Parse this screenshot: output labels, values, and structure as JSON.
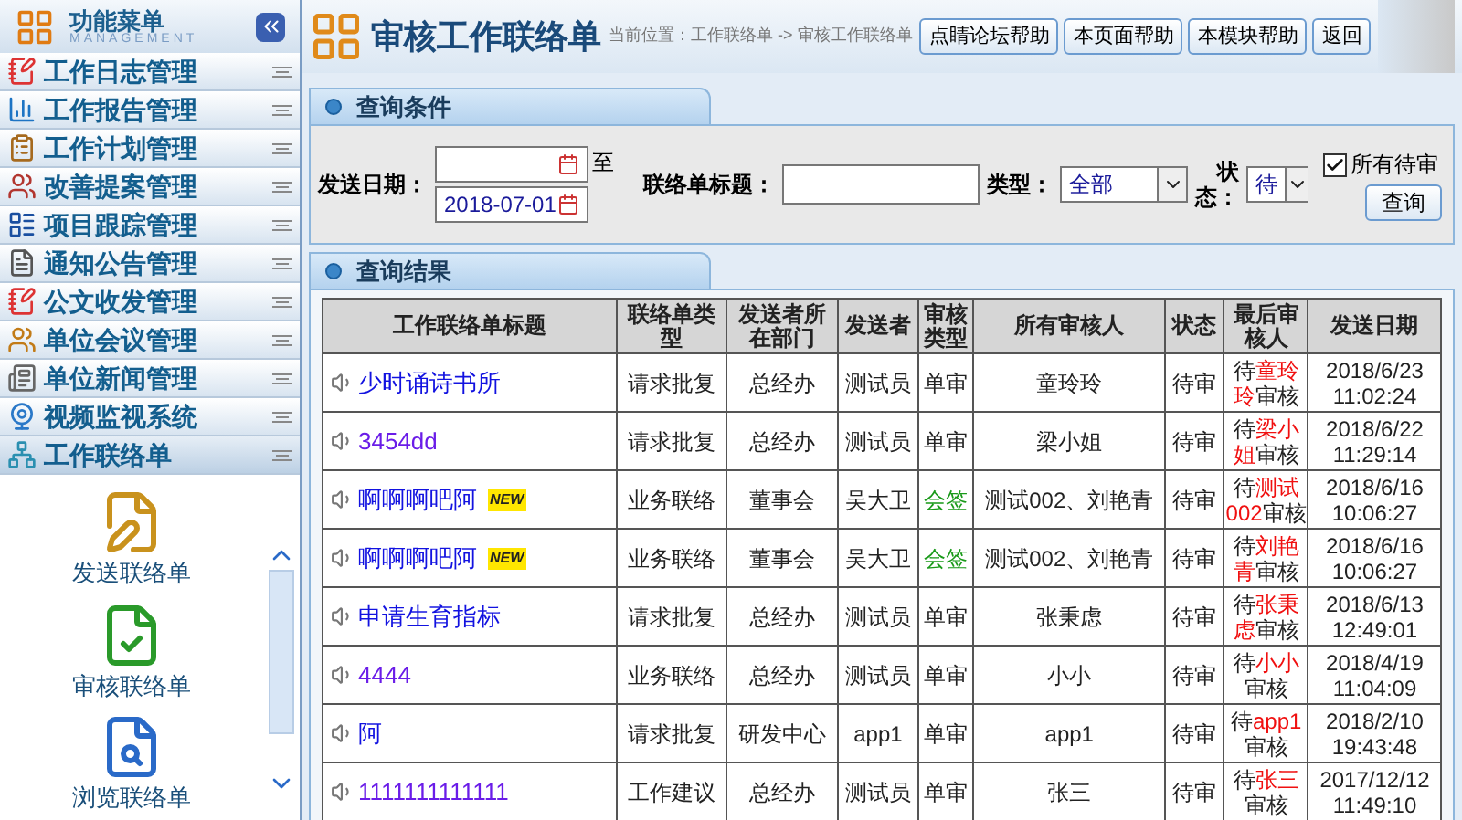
{
  "sidebar": {
    "title": "功能菜单",
    "subtitle": "MANAGEMENT",
    "items": [
      {
        "label": "工作日志管理",
        "expanded": false
      },
      {
        "label": "工作报告管理",
        "expanded": false
      },
      {
        "label": "工作计划管理",
        "expanded": false
      },
      {
        "label": "改善提案管理",
        "expanded": false
      },
      {
        "label": "项目跟踪管理",
        "expanded": false
      },
      {
        "label": "通知公告管理",
        "expanded": false
      },
      {
        "label": "公文收发管理",
        "expanded": false
      },
      {
        "label": "单位会议管理",
        "expanded": false
      },
      {
        "label": "单位新闻管理",
        "expanded": false
      },
      {
        "label": "视频监视系统",
        "expanded": false
      },
      {
        "label": "工作联络单",
        "expanded": true
      }
    ],
    "sub_items": [
      {
        "label": "发送联络单"
      },
      {
        "label": "审核联络单"
      },
      {
        "label": "浏览联络单"
      }
    ]
  },
  "header": {
    "title": "审核工作联络单",
    "breadcrumb": "当前位置：工作联络单 -> 审核工作联络单",
    "buttons": [
      "点睛论坛帮助",
      "本页面帮助",
      "本模块帮助",
      "返回"
    ]
  },
  "query": {
    "title": "查询条件",
    "date_label": "发送日期：",
    "date_sep": "至",
    "date_to": "2018-07-01",
    "subject_label": "联络单标题：",
    "type_label": "类型：",
    "type_value": "全部",
    "status_label": "状态：",
    "status_value": "待",
    "all_pending": {
      "label": "所有待审",
      "checked": true
    },
    "search_button": "查询"
  },
  "results": {
    "title": "查询结果",
    "columns": [
      "工作联络单标题",
      "联络单类型",
      "发送者所在部门",
      "发送者",
      "审核类型",
      "所有审核人",
      "状态",
      "最后审核人",
      "发送日期"
    ],
    "rows": [
      {
        "title": "少时诵诗书所",
        "visited": false,
        "type": "请求批复",
        "dept": "总经办",
        "sender": "测试员",
        "review_type": {
          "text": "单审",
          "kind": "single"
        },
        "reviewers": "童玲玲",
        "status": "待审",
        "last": {
          "prefix": "待",
          "name": "童玲玲",
          "suffix": "审核"
        },
        "date": "2018/6/23 11:02:24"
      },
      {
        "title": "3454dd",
        "visited": true,
        "type": "请求批复",
        "dept": "总经办",
        "sender": "测试员",
        "review_type": {
          "text": "单审",
          "kind": "single"
        },
        "reviewers": "梁小姐",
        "status": "待审",
        "last": {
          "prefix": "待",
          "name": "梁小姐",
          "suffix": "审核"
        },
        "date": "2018/6/22 11:29:14"
      },
      {
        "title": "啊啊啊吧阿",
        "visited": false,
        "badge": "NEW",
        "type": "业务联络",
        "dept": "董事会",
        "sender": "吴大卫",
        "review_type": {
          "text": "会签",
          "kind": "countersign"
        },
        "reviewers": "测试002、刘艳青",
        "status": "待审",
        "last": {
          "prefix": "待",
          "name": "测试002",
          "suffix": "审核"
        },
        "date": "2018/6/16 10:06:27"
      },
      {
        "title": "啊啊啊吧阿",
        "visited": false,
        "badge": "NEW",
        "type": "业务联络",
        "dept": "董事会",
        "sender": "吴大卫",
        "review_type": {
          "text": "会签",
          "kind": "countersign"
        },
        "reviewers": "测试002、刘艳青",
        "status": "待审",
        "last": {
          "prefix": "待",
          "name": "刘艳青",
          "suffix": "审核"
        },
        "date": "2018/6/16 10:06:27"
      },
      {
        "title": "申请生育指标",
        "visited": false,
        "type": "请求批复",
        "dept": "总经办",
        "sender": "测试员",
        "review_type": {
          "text": "单审",
          "kind": "single"
        },
        "reviewers": "张秉虑",
        "status": "待审",
        "last": {
          "prefix": "待",
          "name": "张秉虑",
          "suffix": "审核"
        },
        "date": "2018/6/13 12:49:01"
      },
      {
        "title": "4444",
        "visited": true,
        "type": "业务联络",
        "dept": "总经办",
        "sender": "测试员",
        "review_type": {
          "text": "单审",
          "kind": "single"
        },
        "reviewers": "小小",
        "status": "待审",
        "last": {
          "prefix": "待",
          "name": "小小",
          "suffix": "审核"
        },
        "date": "2018/4/19 11:04:09"
      },
      {
        "title": "阿",
        "visited": false,
        "type": "请求批复",
        "dept": "研发中心",
        "sender": "app1",
        "review_type": {
          "text": "单审",
          "kind": "single"
        },
        "reviewers": "app1",
        "status": "待审",
        "last": {
          "prefix": "待",
          "name": "app1",
          "suffix": "审核"
        },
        "date": "2018/2/10 19:43:48"
      },
      {
        "title": "1111111111111",
        "visited": true,
        "type": "工作建议",
        "dept": "总经办",
        "sender": "测试员",
        "review_type": {
          "text": "单审",
          "kind": "single"
        },
        "reviewers": "张三",
        "status": "待审",
        "last": {
          "prefix": "待",
          "name": "张三",
          "suffix": "审核"
        },
        "date": "2017/12/12 11:49:10"
      }
    ]
  }
}
